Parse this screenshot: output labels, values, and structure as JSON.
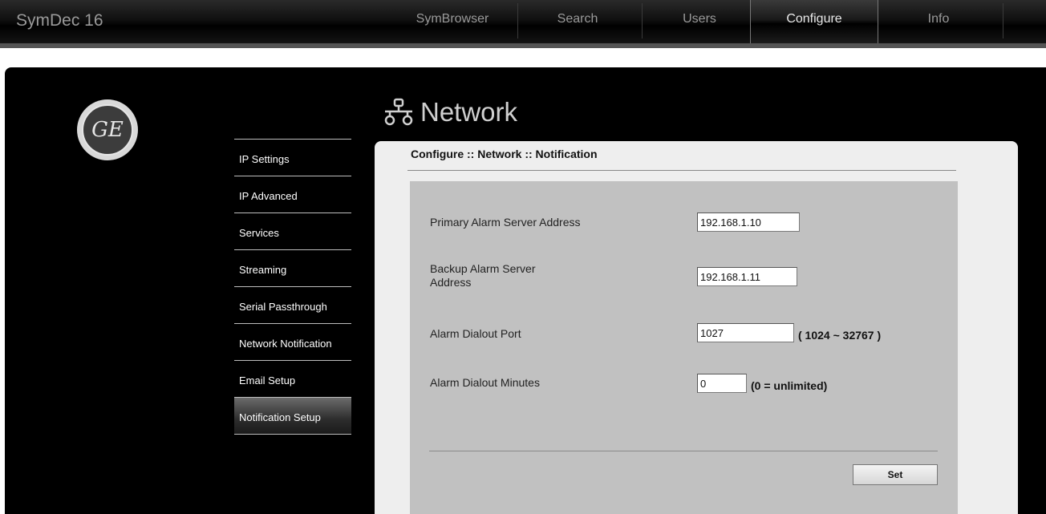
{
  "app": {
    "title": "SymDec 16"
  },
  "nav": {
    "items": [
      {
        "label": "SymBrowser"
      },
      {
        "label": "Search"
      },
      {
        "label": "Users"
      },
      {
        "label": "Configure",
        "active": true
      },
      {
        "label": "Info"
      }
    ]
  },
  "logo": {
    "text": "GE"
  },
  "section": {
    "title": "Network",
    "icon": "network-icon"
  },
  "sidebar": {
    "items": [
      {
        "label": "IP Settings"
      },
      {
        "label": "IP Advanced"
      },
      {
        "label": "Services"
      },
      {
        "label": "Streaming"
      },
      {
        "label": "Serial Passthrough"
      },
      {
        "label": "Network Notification"
      },
      {
        "label": "Email Setup"
      },
      {
        "label": "Notification Setup",
        "active": true
      }
    ]
  },
  "breadcrumb": "Configure :: Network :: Notification",
  "form": {
    "primary": {
      "label": "Primary Alarm Server Address",
      "value": "192.168.1.10"
    },
    "backup": {
      "label_line1": "Backup Alarm Server",
      "label_line2": "Address",
      "value": "192.168.1.11"
    },
    "port": {
      "label": "Alarm Dialout Port",
      "value": "1027",
      "hint": "( 1024 ~ 32767 )"
    },
    "minutes": {
      "label": "Alarm Dialout Minutes",
      "value": "0",
      "hint": "(0 = unlimited)"
    },
    "set_label": "Set"
  },
  "colors": {
    "panel": "#000000",
    "content": "#eeeeee",
    "form": "#c1c1c1"
  }
}
